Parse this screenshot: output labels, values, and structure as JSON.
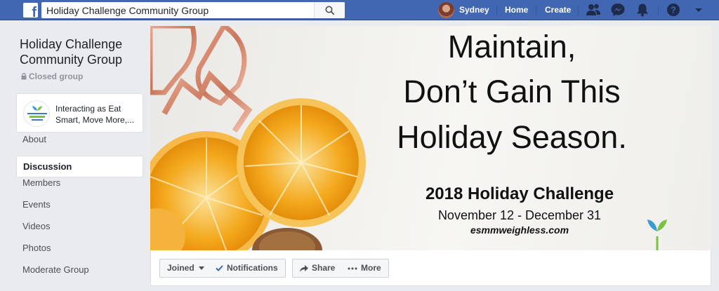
{
  "topbar": {
    "search_value": "Holiday Challenge Community Group",
    "user_name": "Sydney",
    "home_label": "Home",
    "create_label": "Create"
  },
  "group": {
    "title_line1": "Holiday Challenge",
    "title_line2": "Community Group",
    "privacy": "Closed group",
    "interacting_line1": "Interacting as Eat",
    "interacting_line2": "Smart, Move More,..."
  },
  "sidebar": {
    "items": [
      {
        "label": "About",
        "active": false
      },
      {
        "label": "Discussion",
        "active": true
      },
      {
        "label": "Members",
        "active": false
      },
      {
        "label": "Events",
        "active": false
      },
      {
        "label": "Videos",
        "active": false
      },
      {
        "label": "Photos",
        "active": false
      },
      {
        "label": "Moderate Group",
        "active": false
      }
    ]
  },
  "cover": {
    "line1": "Maintain,",
    "line2": "Don’t Gain This",
    "line3": "Holiday Season.",
    "subtitle": "2018 Holiday Challenge",
    "dates": "November 12 - December 31",
    "url": "esmmweighless.com"
  },
  "actions": {
    "joined": "Joined",
    "notifications": "Notifications",
    "share": "Share",
    "more": "More"
  },
  "colors": {
    "topbar": "#4267b2",
    "background": "#e9ebee",
    "link_blue": "#4267b2"
  }
}
